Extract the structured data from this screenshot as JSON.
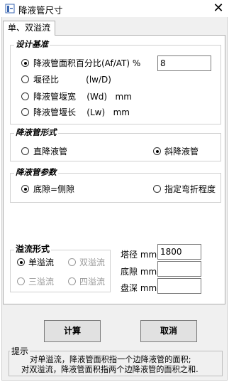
{
  "window": {
    "title": "降液管尺寸",
    "close": "✕"
  },
  "tab": {
    "label": "单、双溢流"
  },
  "design_standard": {
    "heading": "设计基准",
    "options": [
      {
        "label": "降液管面积百分比(Af/AT) %",
        "checked": true
      },
      {
        "label": "堰径比          (lw/D)",
        "checked": false
      },
      {
        "label": "降液管堰宽    (Wd)   mm",
        "checked": false
      },
      {
        "label": "降液管堰长    (Lw)   mm",
        "checked": false
      }
    ],
    "value": "8"
  },
  "downcomer_form": {
    "heading": "降液管形式",
    "options": [
      {
        "label": "直降液管",
        "checked": false
      },
      {
        "label": "斜降液管",
        "checked": true
      }
    ]
  },
  "downcomer_params": {
    "heading": "降液管参数",
    "options": [
      {
        "label": "底隙=侧隙",
        "checked": true
      },
      {
        "label": "指定弯折程度",
        "checked": false
      }
    ]
  },
  "overflow_form": {
    "heading": "溢流形式",
    "options": [
      {
        "label": "单溢流",
        "checked": true,
        "disabled": false
      },
      {
        "label": "双溢流",
        "checked": false,
        "disabled": true
      },
      {
        "label": "三溢流",
        "checked": false,
        "disabled": true
      },
      {
        "label": "四溢流",
        "checked": false,
        "disabled": true
      }
    ]
  },
  "dimensions": {
    "tower_diameter": {
      "label": "塔径 mm",
      "value": "1800"
    },
    "bottom_gap": {
      "label": "底隙 mm",
      "value": ""
    },
    "tray_depth": {
      "label": "盘深 mm",
      "value": ""
    }
  },
  "buttons": {
    "calculate": "计算",
    "cancel": "取消"
  },
  "tips": {
    "heading": "提示",
    "line1": "对单溢流，降液管面积指一个边降液管的面积;",
    "line2": "对双溢流，降液管面积指两个边降液管的面积之和."
  }
}
